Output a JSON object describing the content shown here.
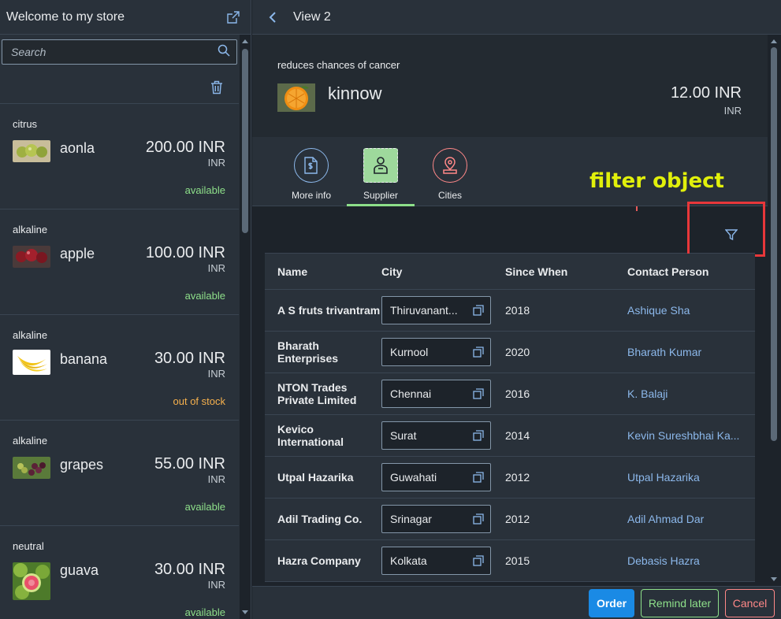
{
  "master": {
    "title": "Welcome to my store",
    "search_placeholder": "Search",
    "items": [
      {
        "category": "citrus",
        "name": "aonla",
        "price": "200.00 INR",
        "unit": "INR",
        "status": "available"
      },
      {
        "category": "alkaline",
        "name": "apple",
        "price": "100.00 INR",
        "unit": "INR",
        "status": "available"
      },
      {
        "category": "alkaline",
        "name": "banana",
        "price": "30.00 INR",
        "unit": "INR",
        "status": "out of stock"
      },
      {
        "category": "alkaline",
        "name": "grapes",
        "price": "55.00 INR",
        "unit": "INR",
        "status": "available"
      },
      {
        "category": "neutral",
        "name": "guava",
        "price": "30.00 INR",
        "unit": "INR",
        "status": "available"
      }
    ]
  },
  "detail": {
    "title": "View 2",
    "object": {
      "intro": "reduces chances of cancer",
      "title": "kinnow",
      "price": "12.00 INR",
      "unit": "INR"
    },
    "tabs": [
      {
        "label": "More info",
        "icon": "document-money-icon"
      },
      {
        "label": "Supplier",
        "icon": "supplier-icon"
      },
      {
        "label": "Cities",
        "icon": "location-icon"
      }
    ],
    "annotation": "filter object",
    "table": {
      "columns": [
        "Name",
        "City",
        "Since When",
        "Contact Person"
      ],
      "rows": [
        {
          "name": "A S fruts trivantram",
          "city": "Thiruvanant...",
          "since": "2018",
          "contact": "Ashique Sha"
        },
        {
          "name": "Bharath Enterprises",
          "city": "Kurnool",
          "since": "2020",
          "contact": "Bharath Kumar"
        },
        {
          "name": "NTON Trades Private Limited",
          "city": "Chennai",
          "since": "2016",
          "contact": "K. Balaji"
        },
        {
          "name": "Kevico International",
          "city": "Surat",
          "since": "2014",
          "contact": "Kevin Sureshbhai Ka..."
        },
        {
          "name": "Utpal Hazarika",
          "city": "Guwahati",
          "since": "2012",
          "contact": "Utpal Hazarika"
        },
        {
          "name": "Adil Trading Co.",
          "city": "Srinagar",
          "since": "2012",
          "contact": "Adil Ahmad Dar"
        },
        {
          "name": "Hazra Company",
          "city": "Kolkata",
          "since": "2015",
          "contact": "Debasis Hazra"
        }
      ]
    },
    "footer": {
      "order": "Order",
      "remind": "Remind later",
      "cancel": "Cancel"
    }
  },
  "colors": {
    "accent": "#1a8ae5",
    "positive": "#8ee08a",
    "warning": "#f5b04d",
    "negative": "#ff8888",
    "link": "#8cb8eb",
    "annotation": "#e1f00b",
    "highlight_box": "#e8373a"
  }
}
